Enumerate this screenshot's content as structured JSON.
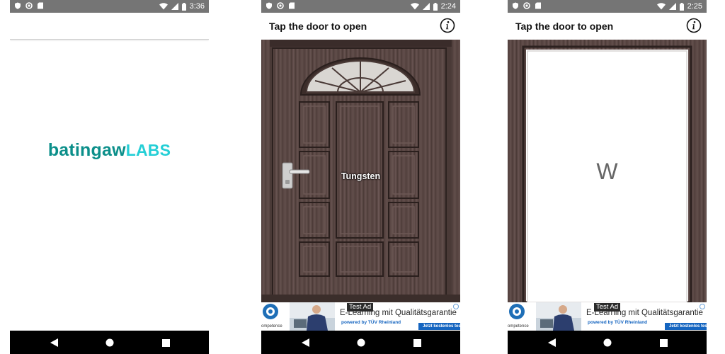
{
  "status_bars": [
    {
      "time": "3:36"
    },
    {
      "time": "2:24"
    },
    {
      "time": "2:25"
    }
  ],
  "splash": {
    "logo_primary": "batingaw",
    "logo_secondary": "LABS"
  },
  "app": {
    "title": "Tap the door to open",
    "info_icon": "info-icon"
  },
  "door_closed": {
    "label": "Tungsten"
  },
  "door_open": {
    "letter": "W"
  },
  "ad": {
    "tag": "Test Ad",
    "headline": "E-Learning mit Qualitätsgarantie",
    "sub": "powered by TÜV Rheinland",
    "cta": "Jetzt kostenlos testen",
    "brand": "ompetence"
  },
  "colors": {
    "status_bar": "#757575",
    "nav_bar": "#000000",
    "logo_primary": "#0b8f8a",
    "logo_secondary": "#25cfd6",
    "door_wood": "#5a4744",
    "ad_blue": "#1565c0"
  }
}
